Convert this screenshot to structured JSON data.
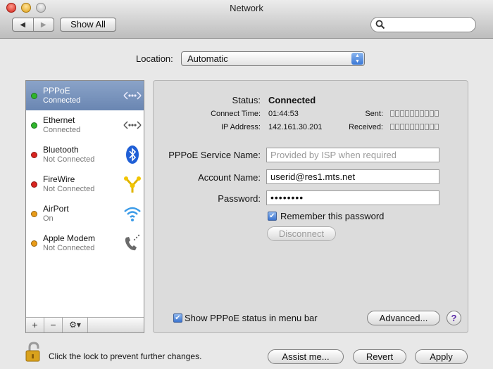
{
  "window": {
    "title": "Network"
  },
  "toolbar": {
    "back_glyph": "◀",
    "forward_glyph": "▶",
    "show_all_label": "Show All",
    "search_value": ""
  },
  "location": {
    "label": "Location:",
    "value": "Automatic"
  },
  "sidebar": {
    "items": [
      {
        "name": "PPPoE",
        "status": "Connected",
        "dot": "#2fb52c",
        "icon": "pppoe-icon"
      },
      {
        "name": "Ethernet",
        "status": "Connected",
        "dot": "#2fb52c",
        "icon": "ethernet-icon"
      },
      {
        "name": "Bluetooth",
        "status": "Not Connected",
        "dot": "#d8241f",
        "icon": "bluetooth-icon"
      },
      {
        "name": "FireWire",
        "status": "Not Connected",
        "dot": "#d8241f",
        "icon": "firewire-icon"
      },
      {
        "name": "AirPort",
        "status": "On",
        "dot": "#e89b19",
        "icon": "airport-icon"
      },
      {
        "name": "Apple Modem",
        "status": "Not Connected",
        "dot": "#e89b19",
        "icon": "modem-icon"
      }
    ],
    "footer": {
      "add": "+",
      "remove": "−",
      "action": "⚙▾"
    }
  },
  "details": {
    "status_label": "Status:",
    "status_value": "Connected",
    "connect_time_label": "Connect Time:",
    "connect_time_value": "01:44:53",
    "ip_label": "IP Address:",
    "ip_value": "142.161.30.201",
    "sent_label": "Sent:",
    "received_label": "Received:",
    "service_name_label": "PPPoE Service Name:",
    "service_name_placeholder": "Provided by ISP when required",
    "account_label": "Account Name:",
    "account_value": "userid@res1.mts.net",
    "password_label": "Password:",
    "password_value": "••••••••",
    "remember_label": "Remember this password",
    "disconnect_label": "Disconnect",
    "show_status_label": "Show PPPoE status in menu bar",
    "advanced_label": "Advanced...",
    "help_label": "?"
  },
  "footer": {
    "lock_text": "Click the lock to prevent further changes.",
    "assist_label": "Assist me...",
    "revert_label": "Revert",
    "apply_label": "Apply"
  },
  "colors": {
    "selected_row": "#7a95bd",
    "accent": "#3b74cf"
  }
}
